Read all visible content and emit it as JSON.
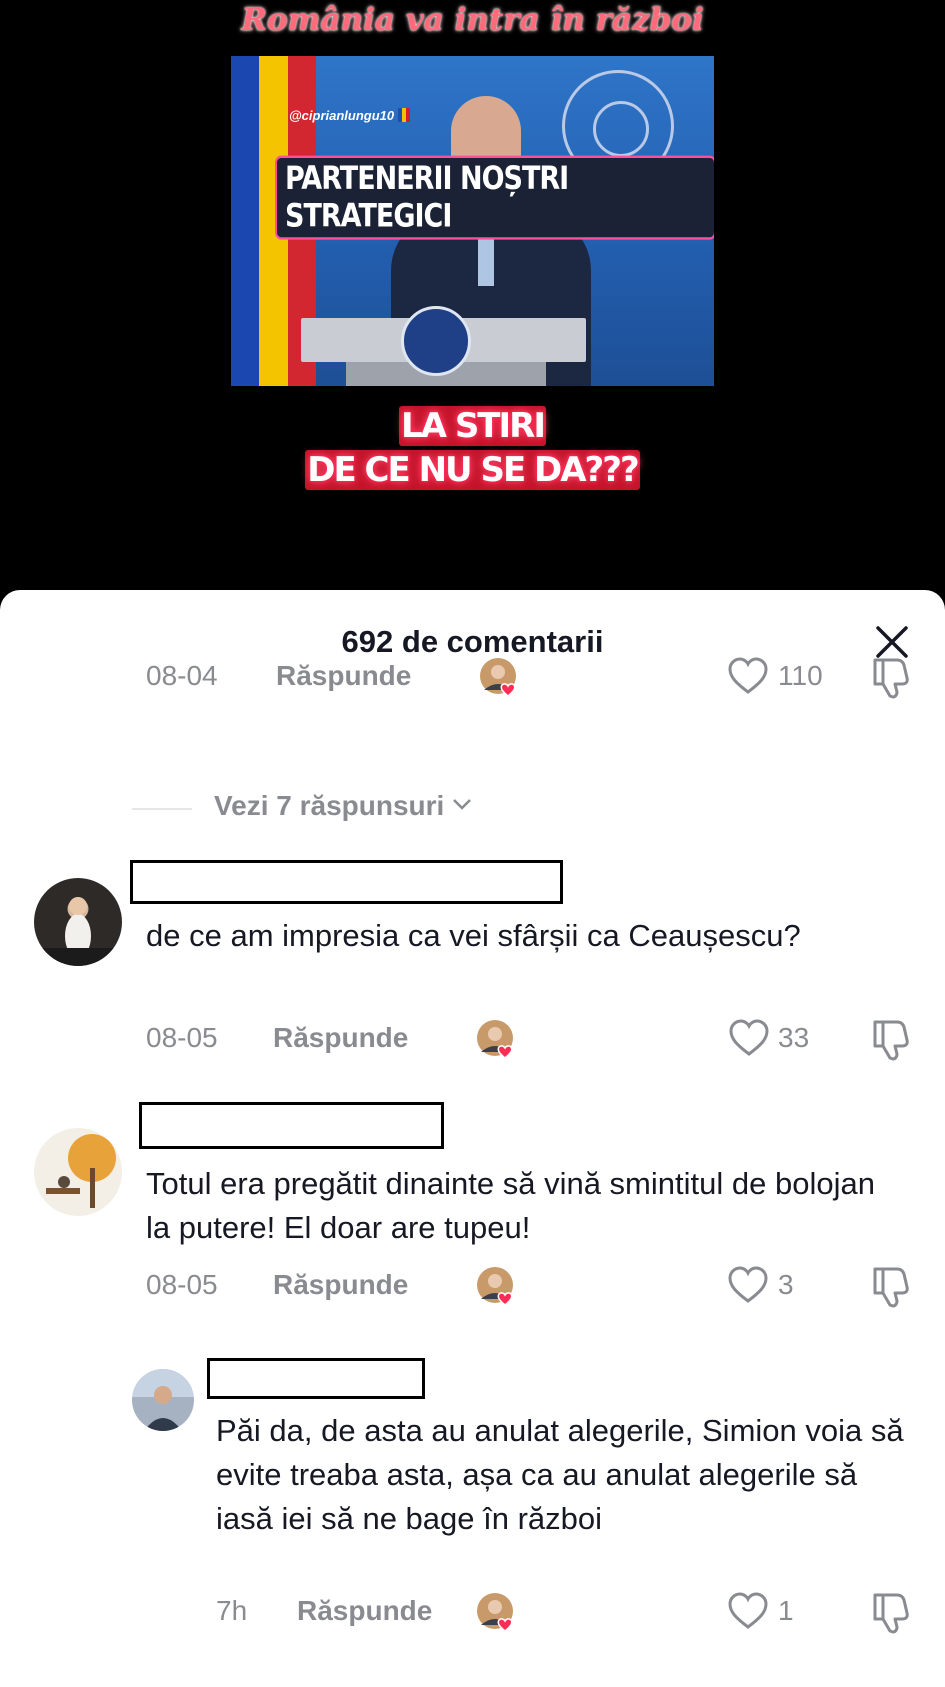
{
  "video": {
    "title": "România va intra în război",
    "handle": "@ciprianlungu10",
    "banner": "PARTENERII NOȘTRI STRATEGICI",
    "overlay_line1": "LA STIRI",
    "overlay_line2": "DE CE NU SE DA???"
  },
  "sheet": {
    "comments_count": "692 de comentarii",
    "close_icon": "close-icon"
  },
  "top_comment": {
    "date": "08-04",
    "reply_label": "Răspunde",
    "likes": "110",
    "view_replies": "Vezi 7 răspunsuri"
  },
  "comments": [
    {
      "text": "de ce am impresia ca vei sfârșii ca Ceaușescu?",
      "date": "08-05",
      "reply_label": "Răspunde",
      "likes": "33"
    },
    {
      "text": "Totul era pregătit dinainte să vină smintitul de bolojan la putere! El doar are tupeu!",
      "date": "08-05",
      "reply_label": "Răspunde",
      "likes": "3"
    },
    {
      "text": "Păi da, de asta au anulat alegerile, Simion voia să evite treaba asta, așa ca au anulat alegerile să iasă iei să ne bage în război",
      "date": "7h",
      "reply_label": "Răspunde",
      "likes": "1"
    }
  ],
  "colors": {
    "like_heart": "#ff2d55",
    "muted_text": "#8a8b91"
  }
}
